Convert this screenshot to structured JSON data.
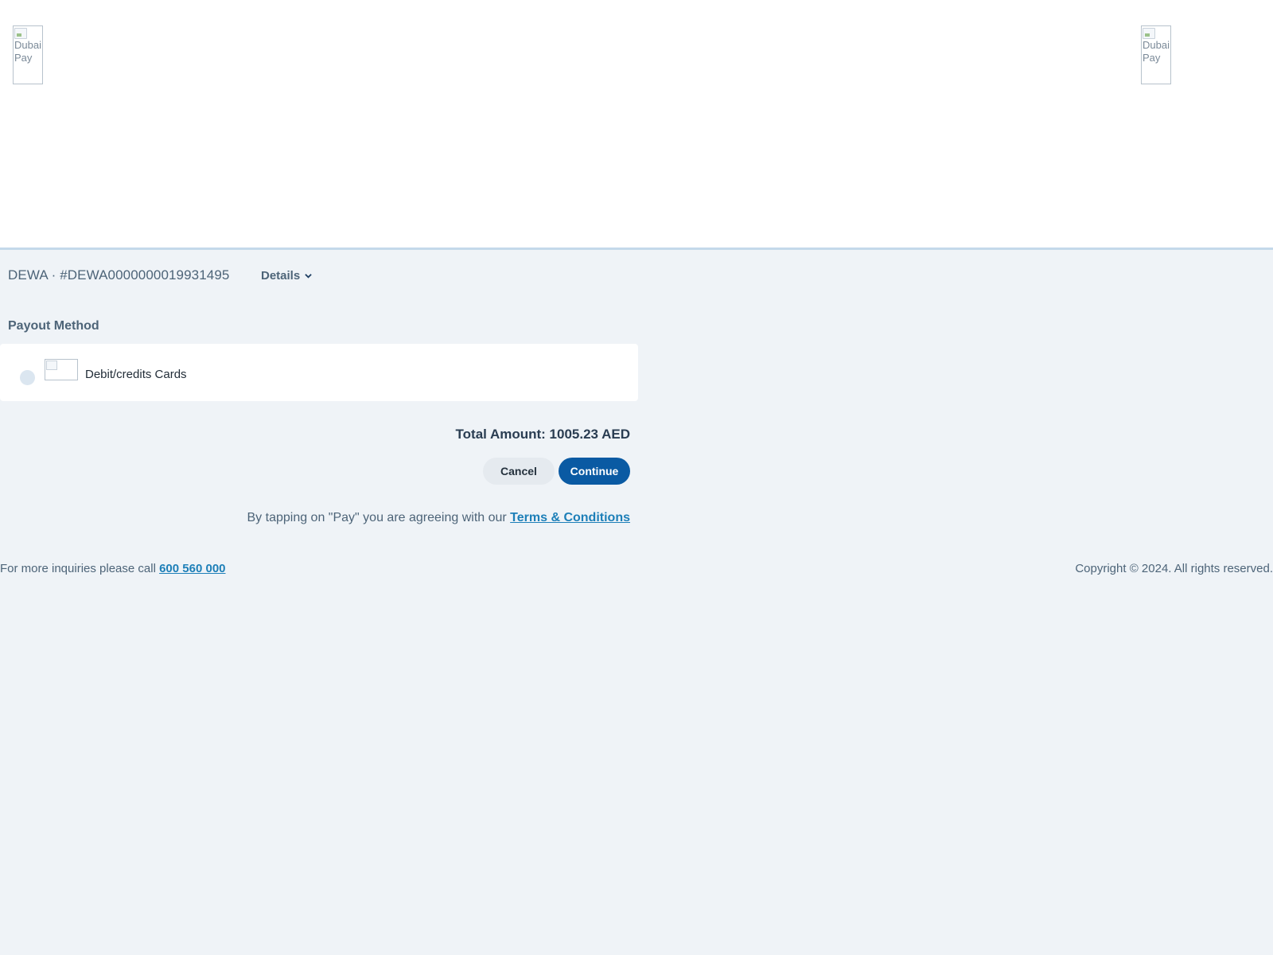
{
  "header": {
    "logo_left_alt": "Dubai Pay",
    "logo_right_alt": "Dubai Pay"
  },
  "order": {
    "reference": "DEWA · #DEWA0000000019931495",
    "details_label": "Details"
  },
  "payout": {
    "section_title": "Payout Method",
    "methods": [
      {
        "label": "Debit/credits Cards",
        "selected": false
      }
    ]
  },
  "summary": {
    "total_text": "Total Amount: 1005.23 AED"
  },
  "actions": {
    "cancel_label": "Cancel",
    "continue_label": "Continue"
  },
  "agreement": {
    "text": "By tapping on \"Pay\" you are agreeing with our ",
    "link_label": "Terms & Conditions"
  },
  "footer": {
    "inquiries_text": "For more inquiries please call ",
    "phone": "600 560 000",
    "copyright": "Copyright © 2024. All rights reserved."
  },
  "colors": {
    "page_bg": "#eff3f7",
    "primary": "#0a5aa3",
    "link": "#1d7fb8",
    "text_muted": "#4d6478"
  }
}
